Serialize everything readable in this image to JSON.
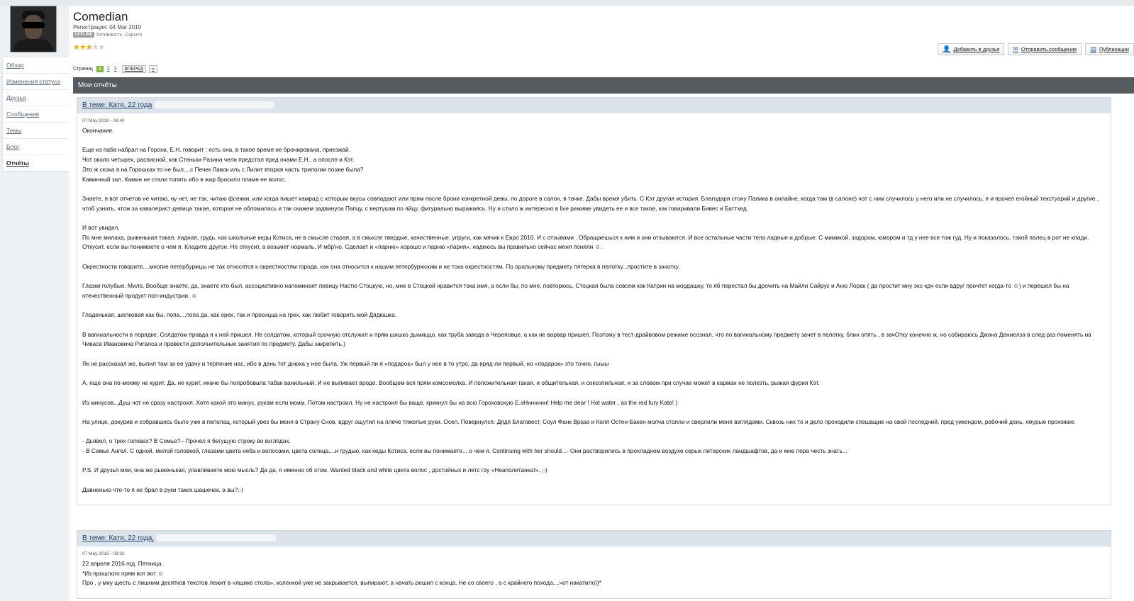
{
  "profile": {
    "username": "Comedian",
    "registration": "Регистрация: 04 Mar 2010",
    "offline_badge": "OFFLINE",
    "activity": "Активность: Скрыто",
    "rating_stars": 3,
    "rating_max": 5
  },
  "sidebar": {
    "items": [
      {
        "label": "Обзор",
        "active": false
      },
      {
        "label": "Изменения статуса",
        "active": false
      },
      {
        "label": "Друзья",
        "active": false
      },
      {
        "label": "Сообщения",
        "active": false
      },
      {
        "label": "Темы",
        "active": false
      },
      {
        "label": "Блог",
        "active": false
      },
      {
        "label": "Отчёты",
        "active": true
      }
    ]
  },
  "actions": {
    "add_friend": "Добавить в друзья",
    "send_message": "Отправить сообщение",
    "publications": "Публикации"
  },
  "pager": {
    "label": "Страниц",
    "current": "1",
    "pages": [
      "2",
      "3"
    ],
    "next": "ВПЕРЕД",
    "last": "»"
  },
  "section": {
    "title": "Мои отчёты"
  },
  "posts": [
    {
      "topic": "В теме: Катя, 22 года",
      "date": "07 May 2016 - 08:40",
      "paragraphs": [
        "Окончание.",
        "Еще из паба набрал на Горохи, Е.Н. говорит : есть она, в такое время не бронирована, приезжай.\nЧот около четырех, расписной, как Стеньки Разина челн предстал пред очами Е.Н., а опосля и Кэт.\nЭто ж скока я на Горошках то не был....с Печек Лавок иль с Лилит вторая часть трилогии позже была?\nКаминный зал. Камин не стали топить ибо в жар бросило пламя ее волос.",
        "Знаете, я вот отчетов не читаю, ну нет, не так, читаю фсежки, или когда пишет камрад с которым вкусы совпадают или прям после брони конкретной девы, по дороге в салон, в тачке. Дабы время убить. С Кэт другая история. Благодаря стону Папика в онлайне, когда там (в салоне) чот с ним случилось у него или не случилось, я и прочел егойный текстуарий и другие , чтоб узнать, чтож за кавалерист-девица такая, которая не обломалась и так скажем задвинула Папцу, с вертушки по яйцу, фигурально выражаясь. Ну и стало ж интересно в live режиме увидеть ее и все такое, как говаривали Бивес и Баттхед.",
        "И вот увидел.\nПо мне милаха, рыженькая такая, ладная, грудь, как школьные кеды Котиса, не в смысле старая, а в смысле твердые, качественные, упруги, как мячик к Евро 2016. И с отзывами . Обращаешься к ним и они отзываются. И все остальные части тела ладные и добрые. С мимикой, задором, юмором и тд у нее все тож гуд. Ну и показалось, такой палец в рот не клади. Откусит, если вы понимаете о чем я. Кладите другое. Не откусит, а возьмет нормаль. И мбр'но. Сделает и «парню» хорошо и парню «парня», надеюсь вы правильно сейчас меня поняли ☺.",
        "Окрестности говорите....многие петербуржцы не так относятся к окрестностям города, как она относится к нашим петербуржским и не тока окрестностям. По оральному предмету пятерка в пелотку...простите в зачотку.",
        "Глазки голубые. Мило. Вообще знаете, да, знаете кто был, ассоциативно напоминает певицу Настю Стоцкую, но, мне в Стоцкой нравится тока имя, а если бы, по мне, повторюсь, Стоцкая была совсем как Катрин на мордашку, то яб перестал бы дрочить на Майли Сайрус и Аню Лорак ( да простит мну экс-кдч если вдруг прочтет когда-то ☺) и перешел бы на отечественный продукт поп-индустрии. ☺",
        "Гладенькая, шелковая как бы, попа....попа да, как орех, так и просицца на грех, как любит говорить мой Дядюшка.",
        "В вагинальности в порядке. Солдатом правда я к ней пришел. Не солдатом, который срочную отслужил и прям шишко дымиццо, как труба завода в Череповце, а как не варвар пришел. Поэтому в тест-драйвовом режиме осознал, что по вагинальному предмету зачет в пелотку, блин опять , в зачОтку конечно ж, но собираюсь Джона Дениелза в след раз поменять на Чиваса Ивановича Ригалса и провести дополнительные занятия по предмету. Дабы закрепить.)",
        "Як не рассказал же, выпил там за ее удачу и терпение нас, ибо в день тот днюха у нее была. Уж первый ли я «подарок» был у нее в то утро, да вряд-ли первый, но «подарок» это точно, гыыы",
        "А, еще она по-моему не курит. Да, не курит, иначе бы попробовала табак ванильный. И не выпивает вроде. Вообщем вся прям комсомолка. И положительная такая, и общительная, и сексопильная, и за словом при случае может в карман не полезть, рыжая фурия Кэт.",
        "Из минусов...Душ чот не сразу настроил. Хотя какой это минус, рукам если моим. Потом настроил. Ну не настроил бы ваще, крикнул бы на всю Гороховскую Е.эНнннннн! Help me dear ! Hot water , as the red fury Kate! )",
        "На улице, докурив и собравшись было уже в пепелац, который увез бы меня в Страну Снов, вдруг ощутил на плече тяжелые руки. Осел. Повернулся. Дядя Благовест, Соул Фанк Враза и Коля Остен-Бакен молча стояли и сверлили меня взглядами. Сквозь них то и дело проходили спешащие на свой последний, пред уикендом, рабочий день, хмурые прохожие.",
        "- Дьявол, о трех головах? В Семье?– Прочел я бегущую строку во взглядах.\n- В Семье Ангел. С одной, милой головкой, глазами цвета неба и волосами, цвета солнца....и грудью, как кеды Котиса, если вы понимаете... о чем я. Continuing with her should...- Они растворились в прохладном воздухе серых питерских ландшафтов, да и мне пора честь знать...",
        "P.S. И друзья мои, она же рыженькая, улавливаете мою мысль? Да да, я именно об этом. Wanted black and white цвета волос , достойных и летс гоу «Неаполитанка!». ;-)",
        "Давненько что-то я не брал в руки таких шашечек, а вы?;-)"
      ]
    },
    {
      "topic": "В теме: Катя, 22 года,",
      "date": "07 May 2016 - 08:32",
      "paragraphs": [
        "22 апреля 2016 год. Пятница.\n*Из прошлого прям вот вот ☺\nПро , у мну щесть с лишним десятков текстов лежит в «ящике стола», коленкой уже не закрывается, выпирают, а начать решил с конца. Не со своего , а с крайнего похода....чот накатило))*"
      ]
    }
  ]
}
